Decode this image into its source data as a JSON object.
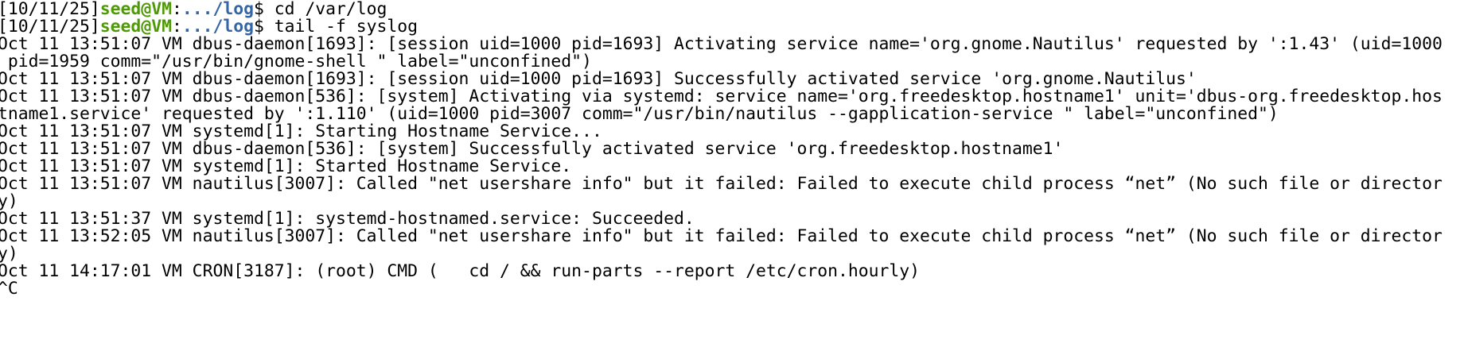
{
  "terminal": {
    "colors": {
      "user": "#4e9a06",
      "path": "#3465a4",
      "text": "#000000",
      "background": "#ffffff"
    },
    "prompts": [
      {
        "date": "[10/11/25]",
        "user": "seed@VM",
        "sep": ":",
        "path": ".../log",
        "dollar": "$ ",
        "command": "cd /var/log"
      },
      {
        "date": "[10/11/25]",
        "user": "seed@VM",
        "sep": ":",
        "path": ".../log",
        "dollar": "$ ",
        "command": "tail -f syslog"
      }
    ],
    "output": [
      "Oct 11 13:51:07 VM dbus-daemon[1693]: [session uid=1000 pid=1693] Activating service name='org.gnome.Nautilus' requested by ':1.43' (uid=1000",
      " pid=1959 comm=\"/usr/bin/gnome-shell \" label=\"unconfined\")",
      "Oct 11 13:51:07 VM dbus-daemon[1693]: [session uid=1000 pid=1693] Successfully activated service 'org.gnome.Nautilus'",
      "Oct 11 13:51:07 VM dbus-daemon[536]: [system] Activating via systemd: service name='org.freedesktop.hostname1' unit='dbus-org.freedesktop.hos",
      "tname1.service' requested by ':1.110' (uid=1000 pid=3007 comm=\"/usr/bin/nautilus --gapplication-service \" label=\"unconfined\")",
      "Oct 11 13:51:07 VM systemd[1]: Starting Hostname Service...",
      "Oct 11 13:51:07 VM dbus-daemon[536]: [system] Successfully activated service 'org.freedesktop.hostname1'",
      "Oct 11 13:51:07 VM systemd[1]: Started Hostname Service.",
      "Oct 11 13:51:07 VM nautilus[3007]: Called \"net usershare info\" but it failed: Failed to execute child process “net” (No such file or director",
      "y)",
      "Oct 11 13:51:37 VM systemd[1]: systemd-hostnamed.service: Succeeded.",
      "Oct 11 13:52:05 VM nautilus[3007]: Called \"net usershare info\" but it failed: Failed to execute child process “net” (No such file or director",
      "y)",
      "Oct 11 14:17:01 VM CRON[3187]: (root) CMD (   cd / && run-parts --report /etc/cron.hourly)",
      "^C"
    ]
  }
}
